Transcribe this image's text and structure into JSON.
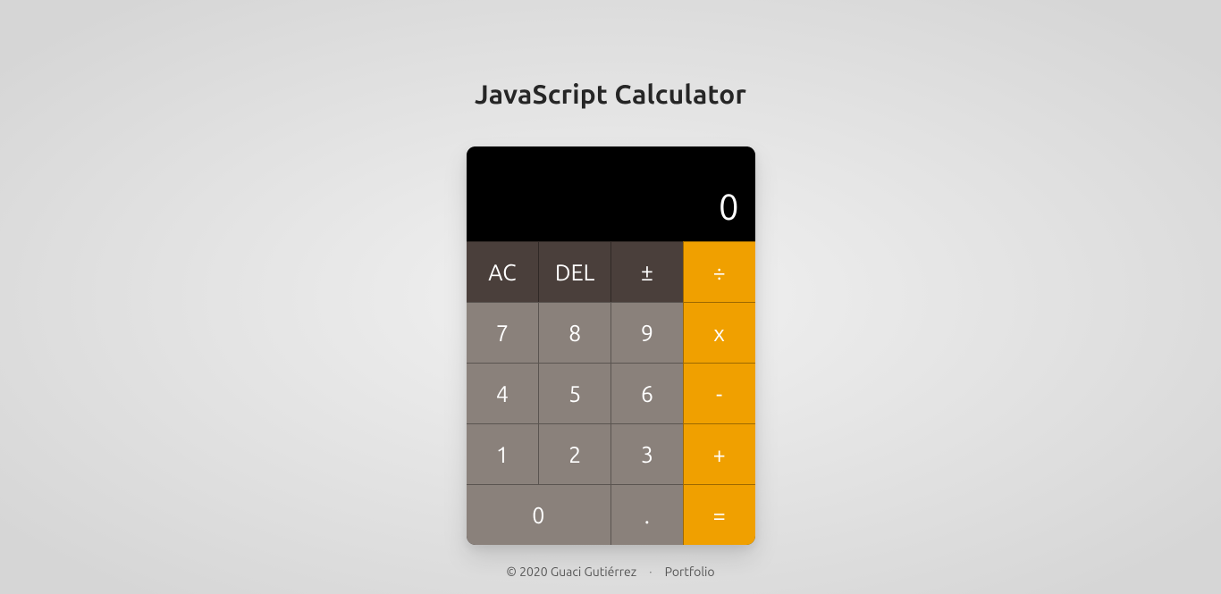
{
  "title": "JavaScript Calculator",
  "display": {
    "value": "0"
  },
  "keys": {
    "ac": "AC",
    "del": "DEL",
    "sign": "±",
    "divide": "÷",
    "seven": "7",
    "eight": "8",
    "nine": "9",
    "multiply": "x",
    "four": "4",
    "five": "5",
    "six": "6",
    "minus": "-",
    "one": "1",
    "two": "2",
    "three": "3",
    "plus": "+",
    "zero": "0",
    "decimal": ".",
    "equals": "="
  },
  "footer": {
    "copyright": "© 2020 Guaci Gutiérrez",
    "separator": "·",
    "portfolio": "Portfolio"
  },
  "colors": {
    "function_key": "#4a3f3b",
    "number_key": "#8a817b",
    "operator_key": "#f0a000",
    "display_bg": "#000000",
    "display_fg": "#ffffff"
  }
}
